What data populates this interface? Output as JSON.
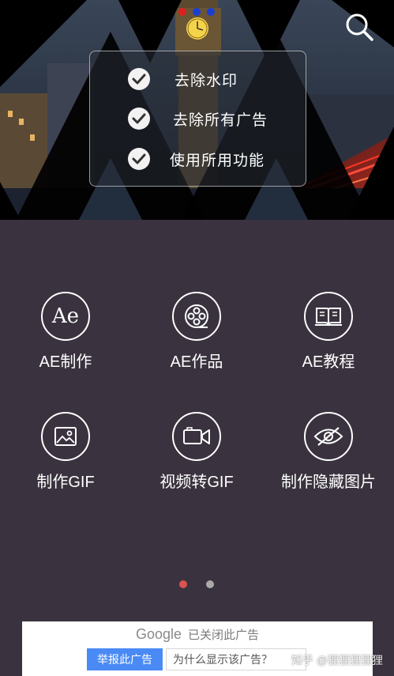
{
  "banner": {
    "features": [
      {
        "label": "去除水印"
      },
      {
        "label": "去除所有广告"
      },
      {
        "label": "使用所用功能"
      }
    ],
    "carousel_dot_colors": [
      "#e02020",
      "#1a3fd0",
      "#1a3fd0"
    ]
  },
  "tools": [
    {
      "label": "AE制作",
      "icon": "ae-logo-icon",
      "icon_text": "Ae"
    },
    {
      "label": "AE作品",
      "icon": "film-reel-icon"
    },
    {
      "label": "AE教程",
      "icon": "open-book-icon"
    },
    {
      "label": "制作GIF",
      "icon": "image-icon"
    },
    {
      "label": "视频转GIF",
      "icon": "video-camera-icon"
    },
    {
      "label": "制作隐藏图片",
      "icon": "eye-off-icon"
    }
  ],
  "pager": {
    "active_color": "#d9534f",
    "inactive_color": "#aaaaaa",
    "active_index": 0,
    "count": 2
  },
  "ad": {
    "brand": "Google",
    "closed_text": "已关闭此广告",
    "report_label": "举报此广告",
    "why_label": "为什么显示该广告？"
  },
  "watermark": "知乎 @狸狸狸狸狸"
}
